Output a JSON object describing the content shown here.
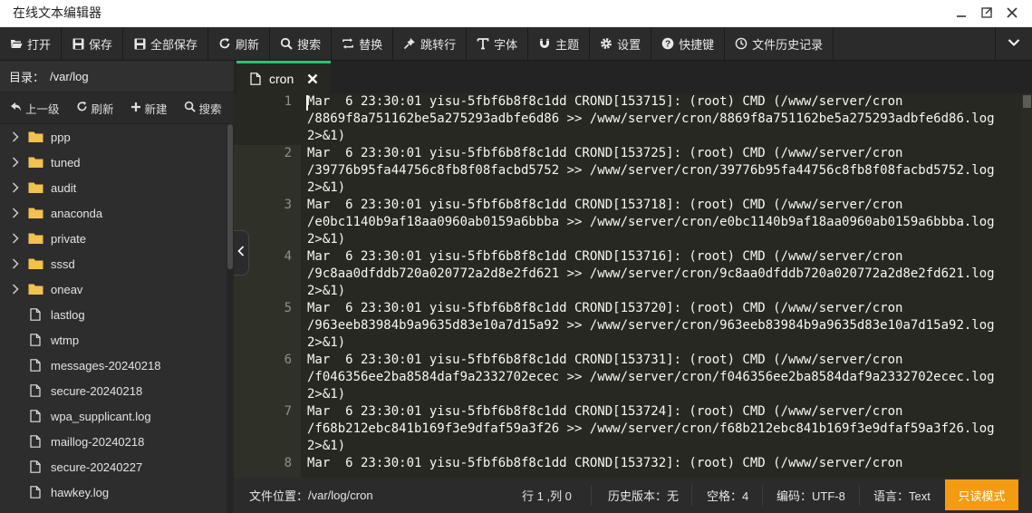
{
  "window": {
    "title": "在线文本编辑器"
  },
  "toolbar": {
    "buttons": [
      {
        "label": "打开",
        "icon": "folder-open-icon"
      },
      {
        "label": "保存",
        "icon": "save-icon"
      },
      {
        "label": "全部保存",
        "icon": "save-all-icon"
      },
      {
        "label": "刷新",
        "icon": "refresh-icon"
      },
      {
        "label": "搜索",
        "icon": "search-icon"
      },
      {
        "label": "替换",
        "icon": "replace-icon"
      },
      {
        "label": "跳转行",
        "icon": "pin-icon"
      },
      {
        "label": "字体",
        "icon": "text-icon"
      },
      {
        "label": "主题",
        "icon": "magnet-icon"
      },
      {
        "label": "设置",
        "icon": "gear-icon"
      },
      {
        "label": "快捷键",
        "icon": "help-icon"
      },
      {
        "label": "文件历史记录",
        "icon": "history-icon"
      }
    ]
  },
  "sidebar": {
    "dir_label": "目录：",
    "dir_path": "/var/log",
    "actions": {
      "up": "上一级",
      "refresh": "刷新",
      "new": "新建",
      "search": "搜索"
    },
    "folders": [
      "ppp",
      "tuned",
      "audit",
      "anaconda",
      "private",
      "sssd",
      "oneav"
    ],
    "files": [
      "lastlog",
      "wtmp",
      "messages-20240218",
      "secure-20240218",
      "wpa_supplicant.log",
      "maillog-20240218",
      "secure-20240227",
      "hawkey.log"
    ]
  },
  "tab": {
    "name": "cron"
  },
  "editor": {
    "lines": [
      {
        "n": "1",
        "text": "Mar  6 23:30:01 yisu-5fbf6b8f8c1dd CROND[153715]: (root) CMD (/www/server/cron\n/8869f8a751162be5a275293adbfe6d86 >> /www/server/cron/8869f8a751162be5a275293adbfe6d86.log\n2>&1)"
      },
      {
        "n": "2",
        "text": "Mar  6 23:30:01 yisu-5fbf6b8f8c1dd CROND[153725]: (root) CMD (/www/server/cron\n/39776b95fa44756c8fb8f08facbd5752 >> /www/server/cron/39776b95fa44756c8fb8f08facbd5752.log\n2>&1)"
      },
      {
        "n": "3",
        "text": "Mar  6 23:30:01 yisu-5fbf6b8f8c1dd CROND[153718]: (root) CMD (/www/server/cron\n/e0bc1140b9af18aa0960ab0159a6bbba >> /www/server/cron/e0bc1140b9af18aa0960ab0159a6bbba.log\n2>&1)"
      },
      {
        "n": "4",
        "text": "Mar  6 23:30:01 yisu-5fbf6b8f8c1dd CROND[153716]: (root) CMD (/www/server/cron\n/9c8aa0dfddb720a020772a2d8e2fd621 >> /www/server/cron/9c8aa0dfddb720a020772a2d8e2fd621.log\n2>&1)"
      },
      {
        "n": "5",
        "text": "Mar  6 23:30:01 yisu-5fbf6b8f8c1dd CROND[153720]: (root) CMD (/www/server/cron\n/963eeb83984b9a9635d83e10a7d15a92 >> /www/server/cron/963eeb83984b9a9635d83e10a7d15a92.log\n2>&1)"
      },
      {
        "n": "6",
        "text": "Mar  6 23:30:01 yisu-5fbf6b8f8c1dd CROND[153731]: (root) CMD (/www/server/cron\n/f046356ee2ba8584daf9a2332702ecec >> /www/server/cron/f046356ee2ba8584daf9a2332702ecec.log\n2>&1)"
      },
      {
        "n": "7",
        "text": "Mar  6 23:30:01 yisu-5fbf6b8f8c1dd CROND[153724]: (root) CMD (/www/server/cron\n/f68b212ebc841b169f3e9dfaf59a3f26 >> /www/server/cron/f68b212ebc841b169f3e9dfaf59a3f26.log\n2>&1)"
      },
      {
        "n": "8",
        "text": "Mar  6 23:30:01 yisu-5fbf6b8f8c1dd CROND[153732]: (root) CMD (/www/server/cron"
      }
    ]
  },
  "status": {
    "file_location_label": "文件位置：",
    "file_location": "/var/log/cron",
    "cursor": "行 1 ,列 0",
    "history": "历史版本：无",
    "indent": "空格：4",
    "encoding": "编码：UTF-8",
    "language": "语言：Text",
    "readonly": "只读模式"
  },
  "colors": {
    "accent": "#2fbf71",
    "readonly": "#f39c12",
    "editor_bg": "#272822"
  }
}
